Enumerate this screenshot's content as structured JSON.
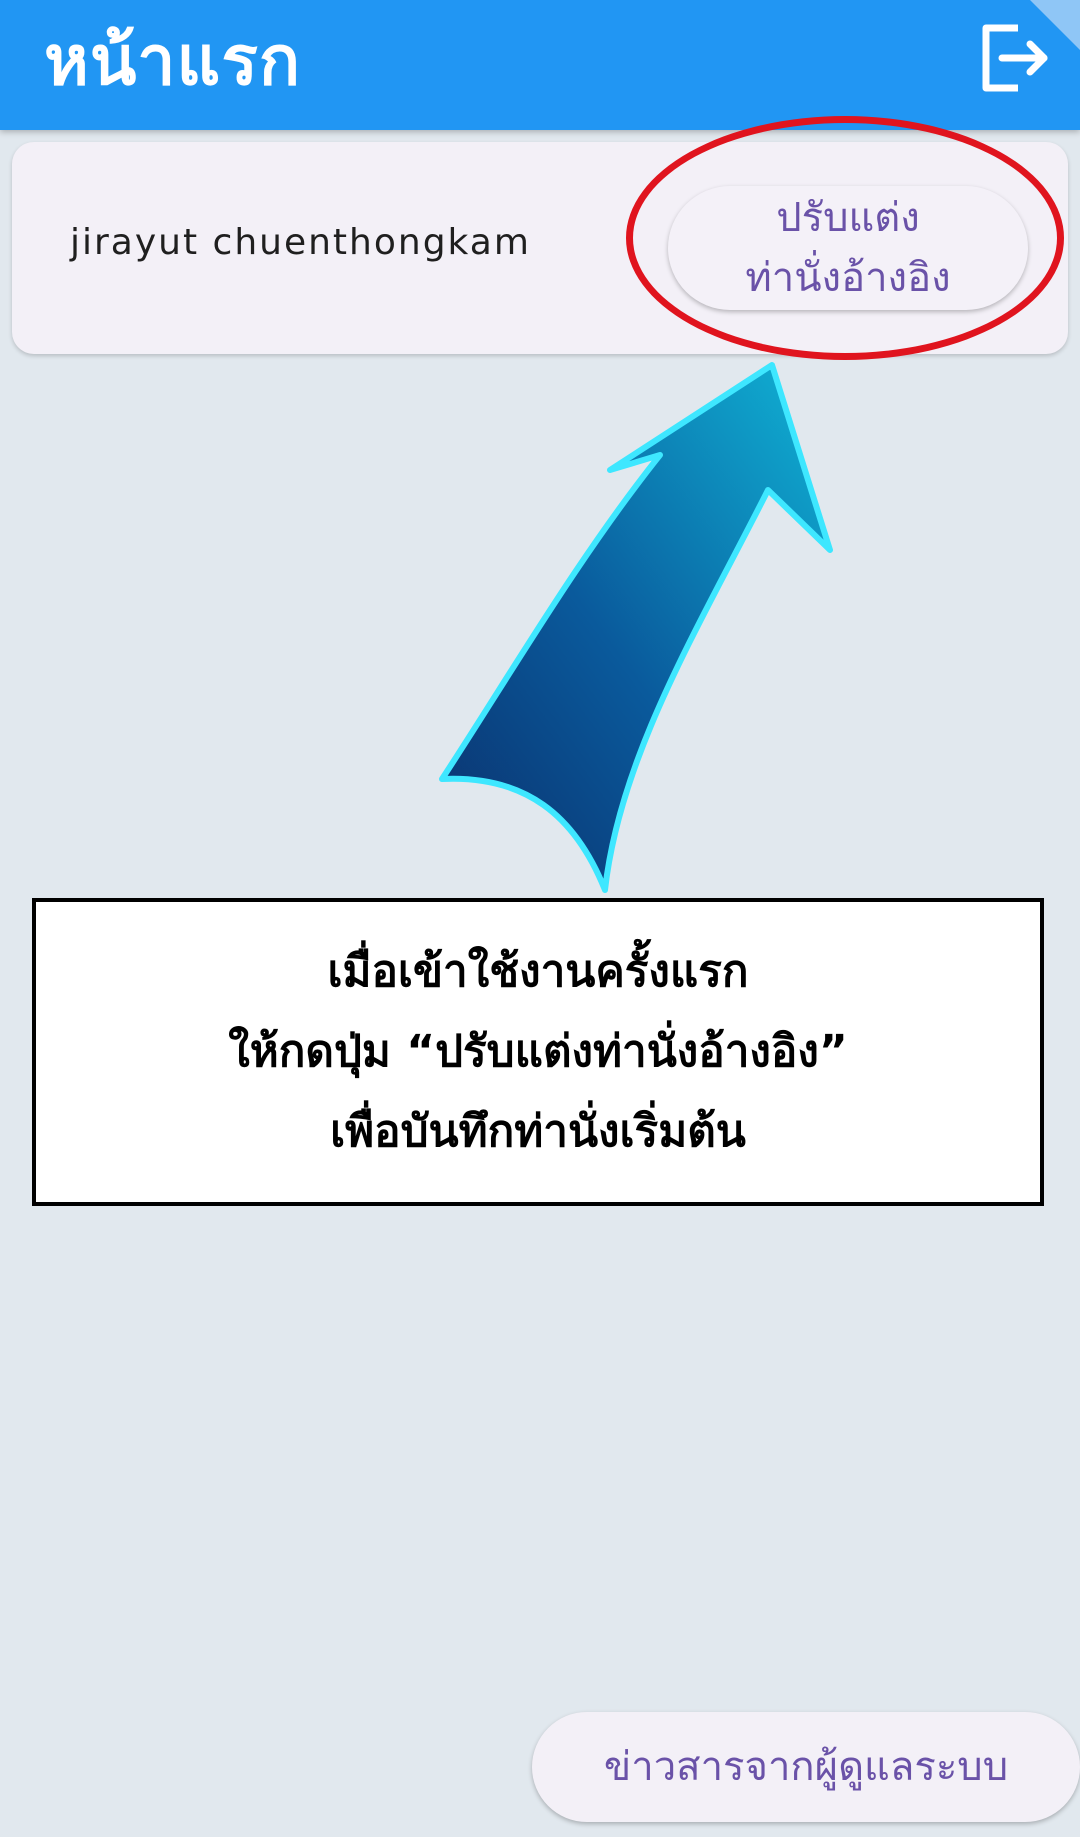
{
  "app_bar": {
    "title": "หน้าแรก",
    "logout_icon": "logout-icon",
    "color": "#2196f3"
  },
  "user_card": {
    "user_name": "jirayut chuenthongkam",
    "adjust_button": {
      "line1": "ปรับแต่ง",
      "line2": "ท่านั่งอ้างอิง"
    }
  },
  "annotation": {
    "highlight_color": "#e0141e",
    "arrow_icon": "pointing-arrow-icon",
    "instruction_lines": [
      "เมื่อเข้าใช้งานครั้งแรก",
      "ให้กดปุ่ม “ปรับแต่งท่านั่งอ้างอิง”",
      "เพื่อบันทึกท่านั่งเริ่มต้น"
    ]
  },
  "footer": {
    "news_button": "ข่าวสารจากผู้ดูแลระบบ"
  },
  "colors": {
    "background": "#e1e8ee",
    "button_text": "#6a52a8"
  }
}
